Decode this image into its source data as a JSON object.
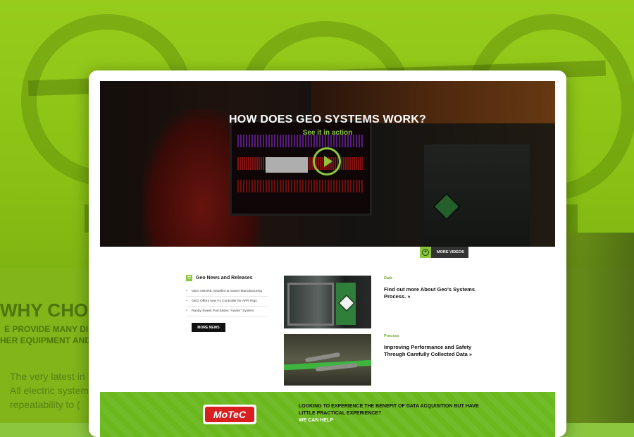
{
  "background": {
    "heading": "WHY CHOO",
    "line1": "E PROVIDE MANY DIST",
    "line2": "HER EQUIPMENT AND",
    "para1": "The very latest in",
    "para2": "All electric system",
    "para3": "repeatability to  ("
  },
  "hero": {
    "title": "HOW DOES GEO SYSTEMS WORK?",
    "subtitle": "See it in action",
    "more_videos": "MORE VIDEOS"
  },
  "news": {
    "title": "Geo News and Releases",
    "items": [
      "GEO AWARE Installed at Sweet Manufacturing",
      "GEO Offers new Fx Controller for APR Rigs",
      "Randy Sweet Purchases \"Aware\" System"
    ],
    "more_label": "MORE NEWS"
  },
  "features": [
    {
      "category": "Data",
      "heading": "Find out more About Geo's Systems Process. »"
    },
    {
      "category": "Process",
      "heading": "Improving Performance and Safety Through Carefully Collected Data »"
    }
  ],
  "band": {
    "logo": "MoTeC",
    "text": "LOOKING TO EXPERIENCE THE BENEFIT OF DATA ACQUISITION BUT HAVE LITTLE PRACTICAL EXPERIENCE?",
    "help": "WE CAN HELP"
  },
  "colors": {
    "accent": "#8cc63f",
    "dark": "#111111"
  },
  "icons": {
    "play": "play-icon",
    "plus": "plus-circle-icon",
    "news": "news-icon"
  }
}
